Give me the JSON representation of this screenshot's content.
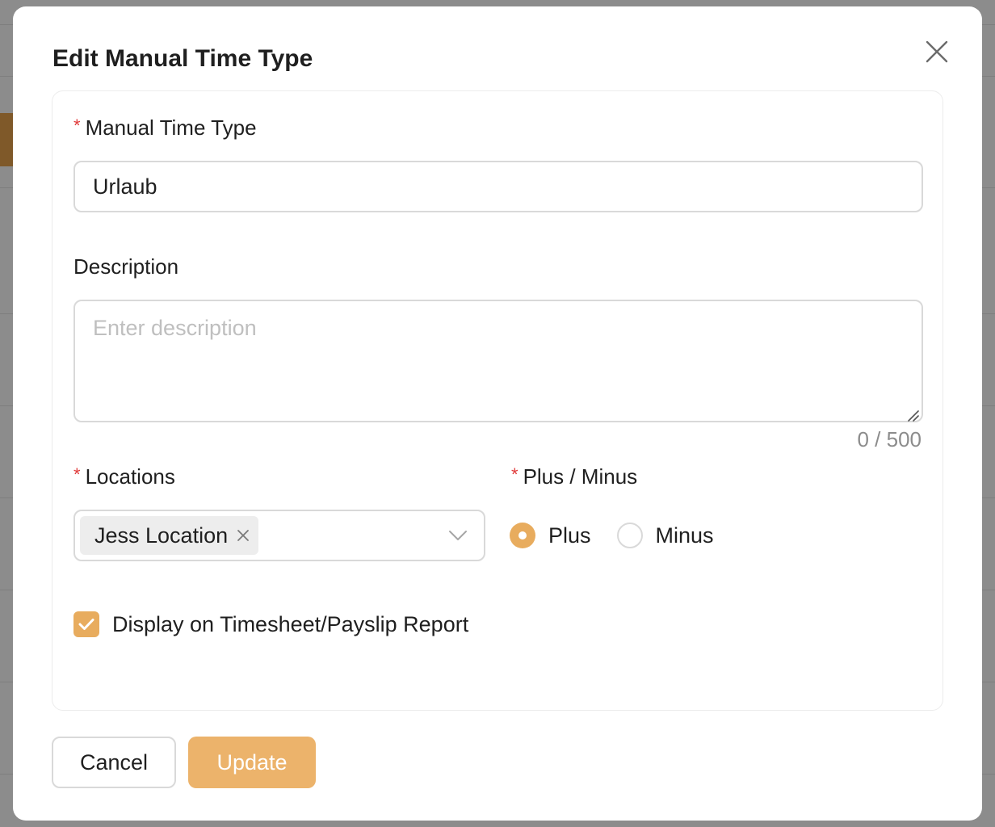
{
  "modal": {
    "title": "Edit Manual Time Type"
  },
  "form": {
    "manual_time_type": {
      "label": "Manual Time Type",
      "required_mark": "*",
      "value": "Urlaub"
    },
    "description": {
      "label": "Description",
      "placeholder": "Enter description",
      "value": "",
      "counter": "0 / 500"
    },
    "locations": {
      "label": "Locations",
      "required_mark": "*",
      "selected_tags": [
        "Jess Location"
      ]
    },
    "plus_minus": {
      "label": "Plus / Minus",
      "required_mark": "*",
      "options": [
        "Plus",
        "Minus"
      ],
      "selected": "Plus"
    },
    "display_on_report": {
      "label": "Display on Timesheet/Payslip Report",
      "checked": true
    }
  },
  "footer": {
    "cancel_label": "Cancel",
    "update_label": "Update"
  },
  "colors": {
    "accent": "#e8ac5e",
    "required": "#e03a3a",
    "border": "#d9d9d9"
  },
  "icons": {
    "close": "close-icon",
    "tag_remove": "tag-remove-icon",
    "dropdown": "chevron-down-icon",
    "checkmark": "checkmark-icon"
  }
}
